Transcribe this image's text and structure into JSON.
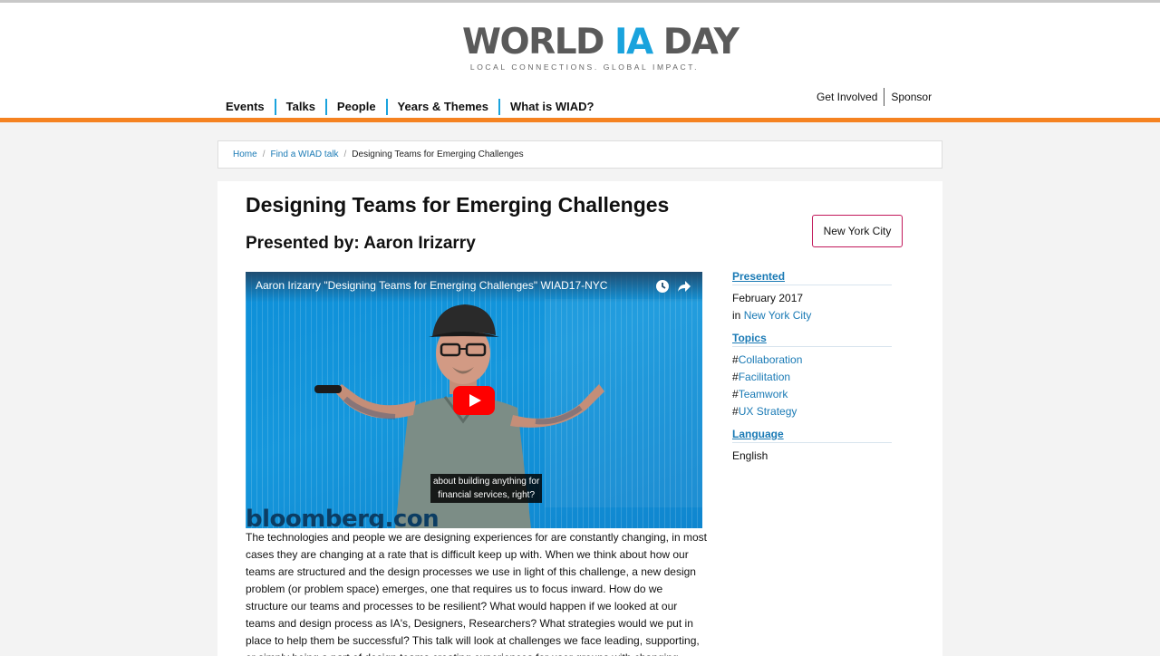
{
  "brand": {
    "logo_part1": "WORLD ",
    "logo_part2": "IA",
    "logo_part3": " DAY",
    "tagline": "LOCAL CONNECTIONS. GLOBAL IMPACT.",
    "accent_color": "#f58220",
    "blue_color": "#1aa3dd"
  },
  "main_nav": [
    "Events",
    "Talks",
    "People",
    "Years & Themes",
    "What is WIAD?"
  ],
  "util_nav": [
    "Get Involved",
    "Sponsor"
  ],
  "breadcrumb": {
    "home": "Home",
    "parent": "Find a WIAD talk",
    "separator": "/",
    "current": "Designing Teams for Emerging Challenges"
  },
  "talk": {
    "title": "Designing Teams for Emerging Challenges",
    "presented_by": "Presented by: Aaron Irizarry",
    "city_button": "New York City",
    "description": "The technologies and people we are designing experiences for are constantly changing, in most cases they are changing at a rate that is difficult keep up with. When we think about how our teams are structured and the design processes we use in light of this challenge, a new design problem (or problem space) emerges, one that requires us to focus inward. How do we structure our teams and processes to be resilient? What would happen if we looked at our teams and design process as IA's, Designers, Researchers? What strategies would we put in place to help them be successful? This talk will look at challenges we face leading, supporting, or simply being a part of design teams creating experiences for user groups with changing"
  },
  "video": {
    "title": "Aaron Irizarry \"Designing Teams for Emerging Challenges\" WIAD17-NYC",
    "caption_line1": "about building anything for",
    "caption_line2": "financial services, right?",
    "watermark": "bloomberg.con",
    "icons": [
      "watch-later-icon",
      "share-icon",
      "play-icon"
    ]
  },
  "sidebar": {
    "presented_heading": "Presented",
    "date": "February 2017",
    "in_label": "in ",
    "city_link": "New York City",
    "topics_heading": "Topics",
    "topics": [
      "Collaboration",
      "Facilitation",
      "Teamwork",
      "UX Strategy"
    ],
    "hash": "#",
    "language_heading": "Language",
    "language": "English"
  }
}
